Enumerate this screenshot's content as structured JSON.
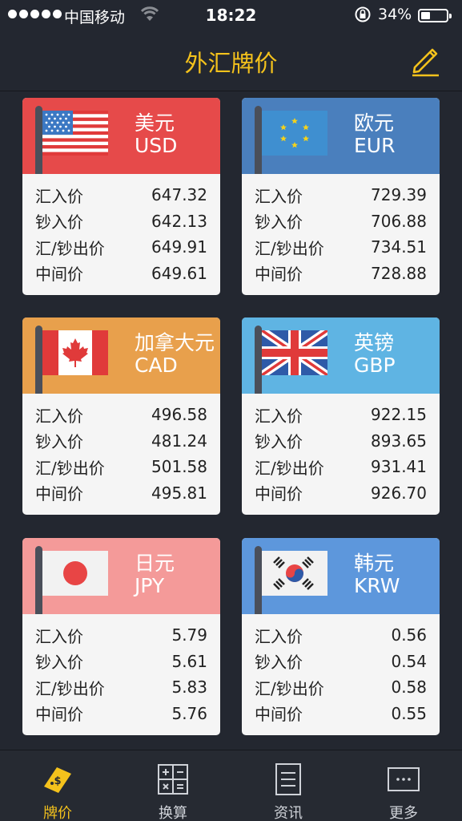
{
  "status_bar": {
    "carrier": "中国移动",
    "time": "18:22",
    "battery": "34%"
  },
  "nav": {
    "title": "外汇牌价"
  },
  "cards": [
    {
      "name": "美元",
      "code": "USD",
      "color": "#e64a4a",
      "flag": "us-flag-icon",
      "rows": [
        {
          "label": "汇入价",
          "value": "647.32"
        },
        {
          "label": "钞入价",
          "value": "642.13"
        },
        {
          "label": "汇/钞出价",
          "value": "649.91"
        },
        {
          "label": "中间价",
          "value": "649.61"
        }
      ]
    },
    {
      "name": "欧元",
      "code": "EUR",
      "color": "#4a7fbd",
      "flag": "eu-flag-icon",
      "rows": [
        {
          "label": "汇入价",
          "value": "729.39"
        },
        {
          "label": "钞入价",
          "value": "706.88"
        },
        {
          "label": "汇/钞出价",
          "value": "734.51"
        },
        {
          "label": "中间价",
          "value": "728.88"
        }
      ]
    },
    {
      "name": "加拿大元",
      "code": "CAD",
      "color": "#e8a04c",
      "flag": "canada-flag-icon",
      "rows": [
        {
          "label": "汇入价",
          "value": "496.58"
        },
        {
          "label": "钞入价",
          "value": "481.24"
        },
        {
          "label": "汇/钞出价",
          "value": "501.58"
        },
        {
          "label": "中间价",
          "value": "495.81"
        }
      ]
    },
    {
      "name": "英镑",
      "code": "GBP",
      "color": "#5fb4e3",
      "flag": "uk-flag-icon",
      "rows": [
        {
          "label": "汇入价",
          "value": "922.15"
        },
        {
          "label": "钞入价",
          "value": "893.65"
        },
        {
          "label": "汇/钞出价",
          "value": "931.41"
        },
        {
          "label": "中间价",
          "value": "926.70"
        }
      ]
    },
    {
      "name": "日元",
      "code": "JPY",
      "color": "#f49a99",
      "flag": "japan-flag-icon",
      "rows": [
        {
          "label": "汇入价",
          "value": "5.79"
        },
        {
          "label": "钞入价",
          "value": "5.61"
        },
        {
          "label": "汇/钞出价",
          "value": "5.83"
        },
        {
          "label": "中间价",
          "value": "5.76"
        }
      ]
    },
    {
      "name": "韩元",
      "code": "KRW",
      "color": "#5d97dc",
      "flag": "korea-flag-icon",
      "rows": [
        {
          "label": "汇入价",
          "value": "0.56"
        },
        {
          "label": "钞入价",
          "value": "0.54"
        },
        {
          "label": "汇/钞出价",
          "value": "0.58"
        },
        {
          "label": "中间价",
          "value": "0.55"
        }
      ]
    }
  ],
  "tabs": [
    {
      "label": "牌价",
      "icon": "price-tag-icon"
    },
    {
      "label": "换算",
      "icon": "calculator-icon"
    },
    {
      "label": "资讯",
      "icon": "news-icon"
    },
    {
      "label": "更多",
      "icon": "more-icon"
    }
  ],
  "colors": {
    "accent": "#f4c21c",
    "background": "#232730"
  }
}
